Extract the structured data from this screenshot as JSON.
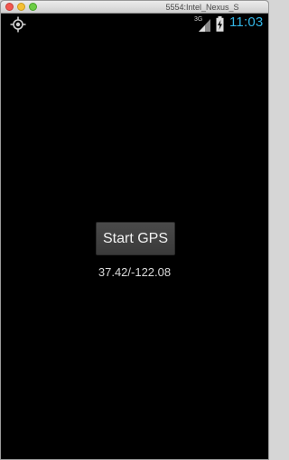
{
  "window": {
    "title": "5554:Intel_Nexus_S"
  },
  "statusbar": {
    "gps_icon": "gps-crosshair-icon",
    "network_type": "3G",
    "signal_icon": "signal-bars-icon",
    "battery_icon": "battery-charging-icon",
    "time": "11:03",
    "time_color": "#33b5e5"
  },
  "main": {
    "start_button_label": "Start GPS",
    "coordinates_text": "37.42/-122.08"
  }
}
